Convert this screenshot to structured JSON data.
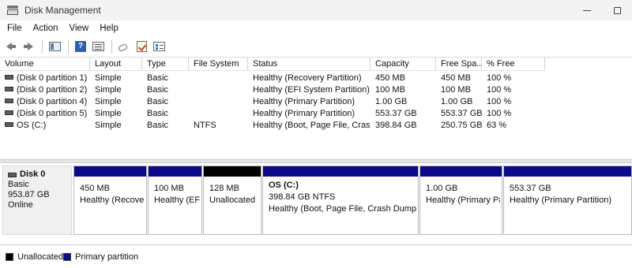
{
  "window": {
    "title": "Disk Management"
  },
  "menu": [
    "File",
    "Action",
    "View",
    "Help"
  ],
  "toolbar": {
    "icons": [
      "back-arrow-icon",
      "forward-arrow-icon",
      "console-tree-icon",
      "help-icon",
      "properties-icon",
      "connect-icon",
      "check-icon",
      "details-icon"
    ]
  },
  "table": {
    "columns": [
      "Volume",
      "Layout",
      "Type",
      "File System",
      "Status",
      "Capacity",
      "Free Spa...",
      "% Free"
    ],
    "rows": [
      [
        "(Disk 0 partition 1)",
        "Simple",
        "Basic",
        "",
        "Healthy (Recovery Partition)",
        "450 MB",
        "450 MB",
        "100 %"
      ],
      [
        "(Disk 0 partition 2)",
        "Simple",
        "Basic",
        "",
        "Healthy (EFI System Partition)",
        "100 MB",
        "100 MB",
        "100 %"
      ],
      [
        "(Disk 0 partition 4)",
        "Simple",
        "Basic",
        "",
        "Healthy (Primary Partition)",
        "1.00 GB",
        "1.00 GB",
        "100 %"
      ],
      [
        "(Disk 0 partition 5)",
        "Simple",
        "Basic",
        "",
        "Healthy (Primary Partition)",
        "553.37 GB",
        "553.37 GB",
        "100 %"
      ],
      [
        "OS (C:)",
        "Simple",
        "Basic",
        "NTFS",
        "Healthy (Boot, Page File, Cras...",
        "398.84 GB",
        "250.75 GB",
        "63 %"
      ]
    ]
  },
  "disk": {
    "name": "Disk 0",
    "type": "Basic",
    "size": "953.87 GB",
    "state": "Online",
    "partitions": [
      {
        "title": "",
        "size": "450 MB",
        "status": "Healthy (Recovery Partition)",
        "bar_color": "#0b0b8a"
      },
      {
        "title": "",
        "size": "100 MB",
        "status": "Healthy (EFI System Partition)",
        "bar_color": "#0b0b8a"
      },
      {
        "title": "",
        "size": "128 MB",
        "status": "Unallocated",
        "bar_color": "#000000"
      },
      {
        "title": "OS  (C:)",
        "size": "398.84 GB NTFS",
        "status": "Healthy (Boot, Page File, Crash Dump, Basic Data Partition)",
        "bar_color": "#0b0b8a"
      },
      {
        "title": "",
        "size": "1.00 GB",
        "status": "Healthy (Primary Partition)",
        "bar_color": "#0b0b8a"
      },
      {
        "title": "",
        "size": "553.37 GB",
        "status": "Healthy (Primary Partition)",
        "bar_color": "#0b0b8a"
      }
    ]
  },
  "legend": [
    {
      "label": "Unallocated",
      "color": "#000000"
    },
    {
      "label": "Primary partition",
      "color": "#0b0b8a"
    }
  ]
}
